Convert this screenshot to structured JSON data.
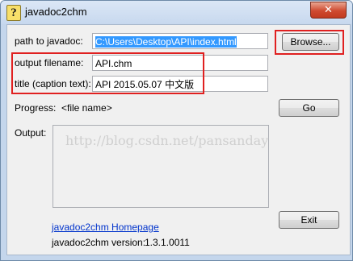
{
  "window": {
    "title": "javadoc2chm",
    "icon": "help-file-icon",
    "close_label": "✕"
  },
  "form": {
    "path_label": "path to javadoc:",
    "path_value": "C:\\Users\\Desktop\\API\\index.html",
    "browse_label": "Browse...",
    "output_label": "output filename:",
    "output_value": "API.chm",
    "caption_label": "title (caption text):",
    "caption_value": "API 2015.05.07 中文版",
    "progress_label": "Progress:",
    "progress_value": "<file name>",
    "go_label": "Go",
    "output_area_label": "Output:",
    "watermark": "http://blog.csdn.net/pansanday"
  },
  "footer": {
    "homepage_link": "javadoc2chm Homepage",
    "version_label": "javadoc2chm version:",
    "version_value": "1.3.1.0011",
    "exit_label": "Exit"
  },
  "colors": {
    "annotation_red": "#e02020",
    "selection_blue": "#3399ff",
    "link_blue": "#0033cc"
  }
}
